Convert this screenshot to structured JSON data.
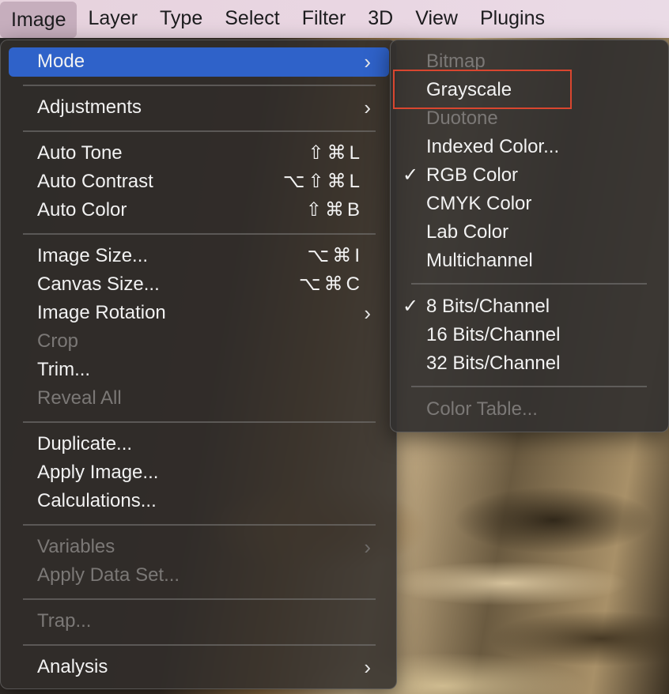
{
  "menubar": {
    "items": [
      "Image",
      "Layer",
      "Type",
      "Select",
      "Filter",
      "3D",
      "View",
      "Plugins"
    ]
  },
  "image_menu": {
    "mode": "Mode",
    "adjustments": "Adjustments",
    "auto_tone": "Auto Tone",
    "auto_tone_shortcut": "⇧⌘L",
    "auto_contrast": "Auto Contrast",
    "auto_contrast_shortcut": "⌥⇧⌘L",
    "auto_color": "Auto Color",
    "auto_color_shortcut": "⇧⌘B",
    "image_size": "Image Size...",
    "image_size_shortcut": "⌥⌘I",
    "canvas_size": "Canvas Size...",
    "canvas_size_shortcut": "⌥⌘C",
    "image_rotation": "Image Rotation",
    "crop": "Crop",
    "trim": "Trim...",
    "reveal_all": "Reveal All",
    "duplicate": "Duplicate...",
    "apply_image": "Apply Image...",
    "calculations": "Calculations...",
    "variables": "Variables",
    "apply_data_set": "Apply Data Set...",
    "trap": "Trap...",
    "analysis": "Analysis",
    "chevron": "›"
  },
  "mode_submenu": {
    "bitmap": "Bitmap",
    "grayscale": "Grayscale",
    "duotone": "Duotone",
    "indexed_color": "Indexed Color...",
    "rgb_color": "RGB Color",
    "cmyk_color": "CMYK Color",
    "lab_color": "Lab Color",
    "multichannel": "Multichannel",
    "bits8": "8 Bits/Channel",
    "bits16": "16 Bits/Channel",
    "bits32": "32 Bits/Channel",
    "color_table": "Color Table...",
    "checkmark": "✓"
  },
  "colors": {
    "highlight": "#2f62c9",
    "annotation_box": "#d9462f"
  }
}
